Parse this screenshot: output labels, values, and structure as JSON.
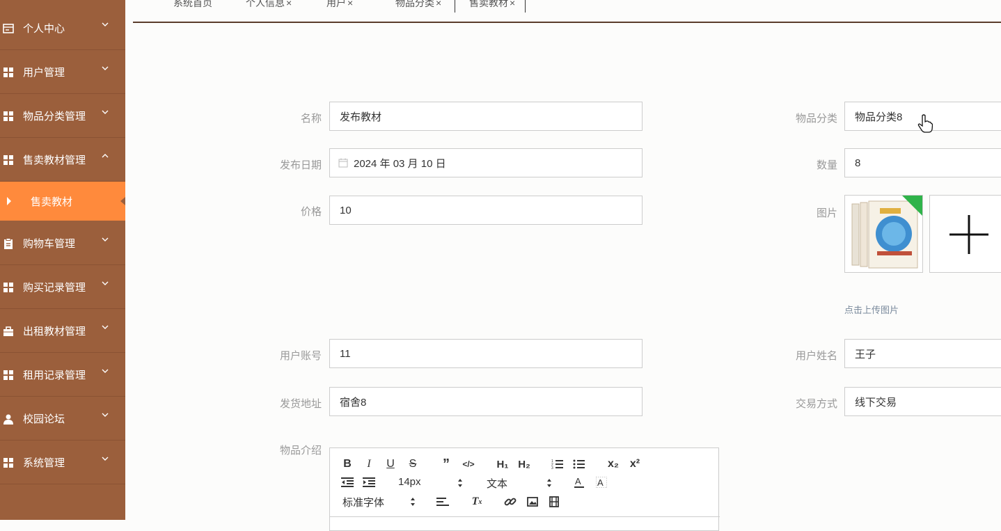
{
  "sidebar": {
    "items": [
      {
        "label": "个人中心",
        "icon": "profile-card-icon",
        "expanded": false
      },
      {
        "label": "用户管理",
        "icon": "grid-icon",
        "expanded": false
      },
      {
        "label": "物品分类管理",
        "icon": "grid-icon",
        "expanded": false
      },
      {
        "label": "售卖教材管理",
        "icon": "grid-icon",
        "expanded": true
      },
      {
        "label": "购物车管理",
        "icon": "clipboard-icon",
        "expanded": false
      },
      {
        "label": "购买记录管理",
        "icon": "grid-icon",
        "expanded": false
      },
      {
        "label": "出租教材管理",
        "icon": "briefcase-icon",
        "expanded": false
      },
      {
        "label": "租用记录管理",
        "icon": "grid-icon",
        "expanded": false
      },
      {
        "label": "校园论坛",
        "icon": "user-icon",
        "expanded": false
      },
      {
        "label": "系统管理",
        "icon": "grid-icon",
        "expanded": false
      }
    ],
    "active_sub": "售卖教材",
    "colors": {
      "bg": "#9b5f3c",
      "active": "#ff8a3c"
    }
  },
  "tabs": [
    {
      "label": "系统首页",
      "closable": false
    },
    {
      "label": "个人信息",
      "closable": true
    },
    {
      "label": "用户",
      "closable": true
    },
    {
      "label": "物品分类",
      "closable": true
    },
    {
      "label": "售卖教材",
      "closable": true,
      "active": true
    }
  ],
  "tab_close_glyph": "×",
  "form": {
    "name": {
      "label": "名称",
      "value": "发布教材"
    },
    "category": {
      "label": "物品分类",
      "value": "物品分类8"
    },
    "publish_date": {
      "label": "发布日期",
      "value": "2024 年 03 月 10 日"
    },
    "quantity": {
      "label": "数量",
      "value": "8"
    },
    "price": {
      "label": "价格",
      "value": "10"
    },
    "image": {
      "label": "图片",
      "hint": "点击上传图片"
    },
    "user_account": {
      "label": "用户账号",
      "value": "11"
    },
    "user_name": {
      "label": "用户姓名",
      "value": "王子"
    },
    "ship_address": {
      "label": "发货地址",
      "value": "宿舍8"
    },
    "trade_method": {
      "label": "交易方式",
      "value": "线下交易"
    },
    "description": {
      "label": "物品介绍"
    }
  },
  "editor": {
    "font_size": "14px",
    "block_type": "文本",
    "font_family": "标准字体"
  }
}
